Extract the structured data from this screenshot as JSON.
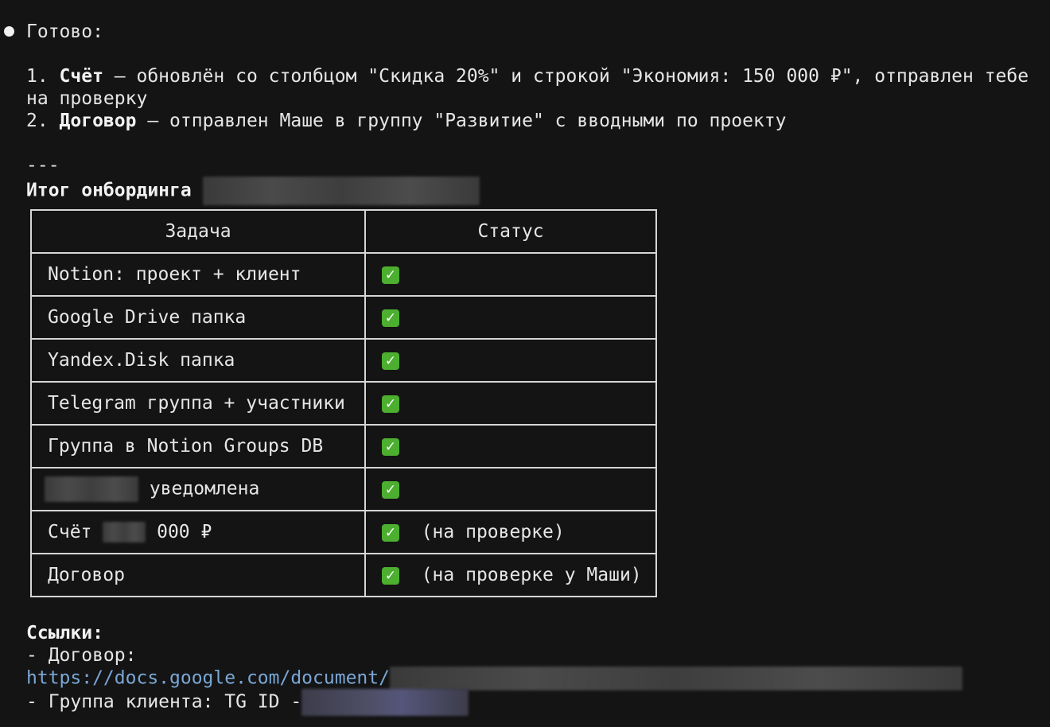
{
  "intro": {
    "status": "Готово:",
    "item1_num": "1. ",
    "item1_bold": "Счёт",
    "item1_text": " — обновлён со столбцом \"Скидка 20%\" и строкой \"Экономия: 150 000 ₽\", отправлен тебе",
    "item1_cont": "на проверку",
    "item2_num": "2. ",
    "item2_bold": "Договор",
    "item2_text": " — отправлен Маше в группу \"Развитие\" с вводными по проекту"
  },
  "separator": "---",
  "summary_title": "Итог онбординга",
  "table": {
    "headers": [
      "Задача",
      "Статус"
    ],
    "rows": [
      {
        "task": "Notion: проект + клиент",
        "note": ""
      },
      {
        "task": "Google Drive папка",
        "note": ""
      },
      {
        "task": "Yandex.Disk папка",
        "note": ""
      },
      {
        "task": "Telegram группа + участники",
        "note": ""
      },
      {
        "task": "Группа в Notion Groups DB",
        "note": ""
      },
      {
        "task": "уведомлена",
        "note": ""
      },
      {
        "task_prefix": "Счёт ",
        "task": "000 ₽",
        "note": "(на проверке)"
      },
      {
        "task": "Договор",
        "note": "(на проверке у Маши)"
      }
    ],
    "status_icon": "check-mark-icon",
    "check_color": "#4caf2f"
  },
  "links": {
    "title": "Ссылки:",
    "contract_label": "- Договор:",
    "contract_url": "https://docs.google.com/document/",
    "group_label": "- Группа клиента: TG ID -"
  },
  "colors": {
    "background": "#141414",
    "text": "#e6e6e6",
    "link": "#7aa7d6",
    "table_border": "#d6d6d6"
  }
}
